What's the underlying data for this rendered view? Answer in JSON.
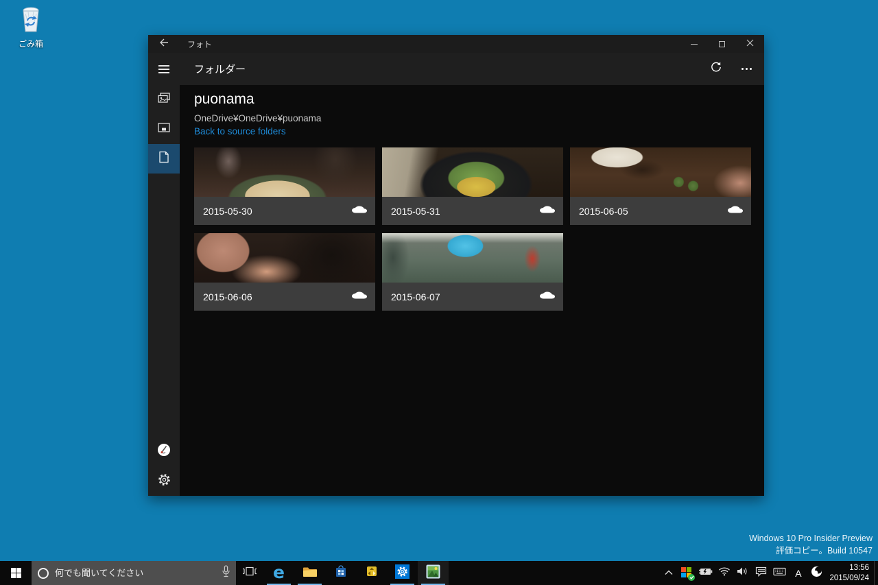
{
  "desktop": {
    "recycle_bin_label": "ごみ箱",
    "watermark": {
      "line1": "Windows 10 Pro Insider Preview",
      "line2": "評価コピー。Build 10547"
    }
  },
  "app": {
    "titlebar": {
      "title": "フォト"
    },
    "header": {
      "title": "フォルダー"
    },
    "folder": {
      "name": "puonama",
      "path": "OneDrive¥OneDrive¥puonama",
      "back_link": "Back to source folders"
    },
    "tiles": [
      {
        "date": "2015-05-30",
        "sync_icon": "onedrive-cloud"
      },
      {
        "date": "2015-05-31",
        "sync_icon": "onedrive-cloud"
      },
      {
        "date": "2015-06-05",
        "sync_icon": "onedrive-cloud"
      },
      {
        "date": "2015-06-06",
        "sync_icon": "onedrive-cloud"
      },
      {
        "date": "2015-06-07",
        "sync_icon": "onedrive-cloud"
      }
    ]
  },
  "taskbar": {
    "search_placeholder": "何でも聞いてください",
    "edge_glyph": "e",
    "ime_mode": "A",
    "clock": {
      "time": "13:56",
      "date": "2015/09/24"
    }
  },
  "colors": {
    "desktop_background": "#0f7db1",
    "accent": "#0078d7",
    "link": "#1e8bd8",
    "sidebar_selected": "#1b4a6e",
    "tile_bar": "#3d3d3d"
  }
}
